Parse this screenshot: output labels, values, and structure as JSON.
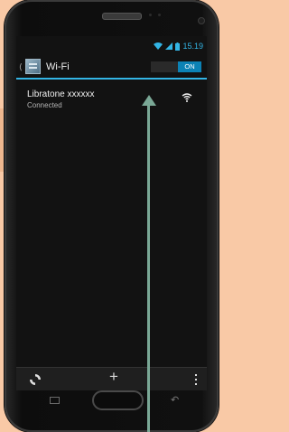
{
  "status_bar": {
    "time": "15.19",
    "icons": [
      "wifi-icon",
      "cell-signal-icon",
      "battery-icon"
    ]
  },
  "action_bar": {
    "title": "Wi-Fi",
    "toggle_label": "ON",
    "icon": "settings-icon"
  },
  "networks": [
    {
      "name": "Libratone xxxxxx",
      "status": "Connected",
      "icon": "wifi-signal-icon"
    }
  ],
  "bottom_bar": {
    "icons": [
      "wps-icon",
      "add-icon",
      "overflow-menu-icon"
    ],
    "add_label": "+"
  },
  "colors": {
    "accent": "#33b5e5",
    "toggle_on": "#0c82b5",
    "background": "#f9c9a6",
    "arrow": "#7aa896"
  }
}
